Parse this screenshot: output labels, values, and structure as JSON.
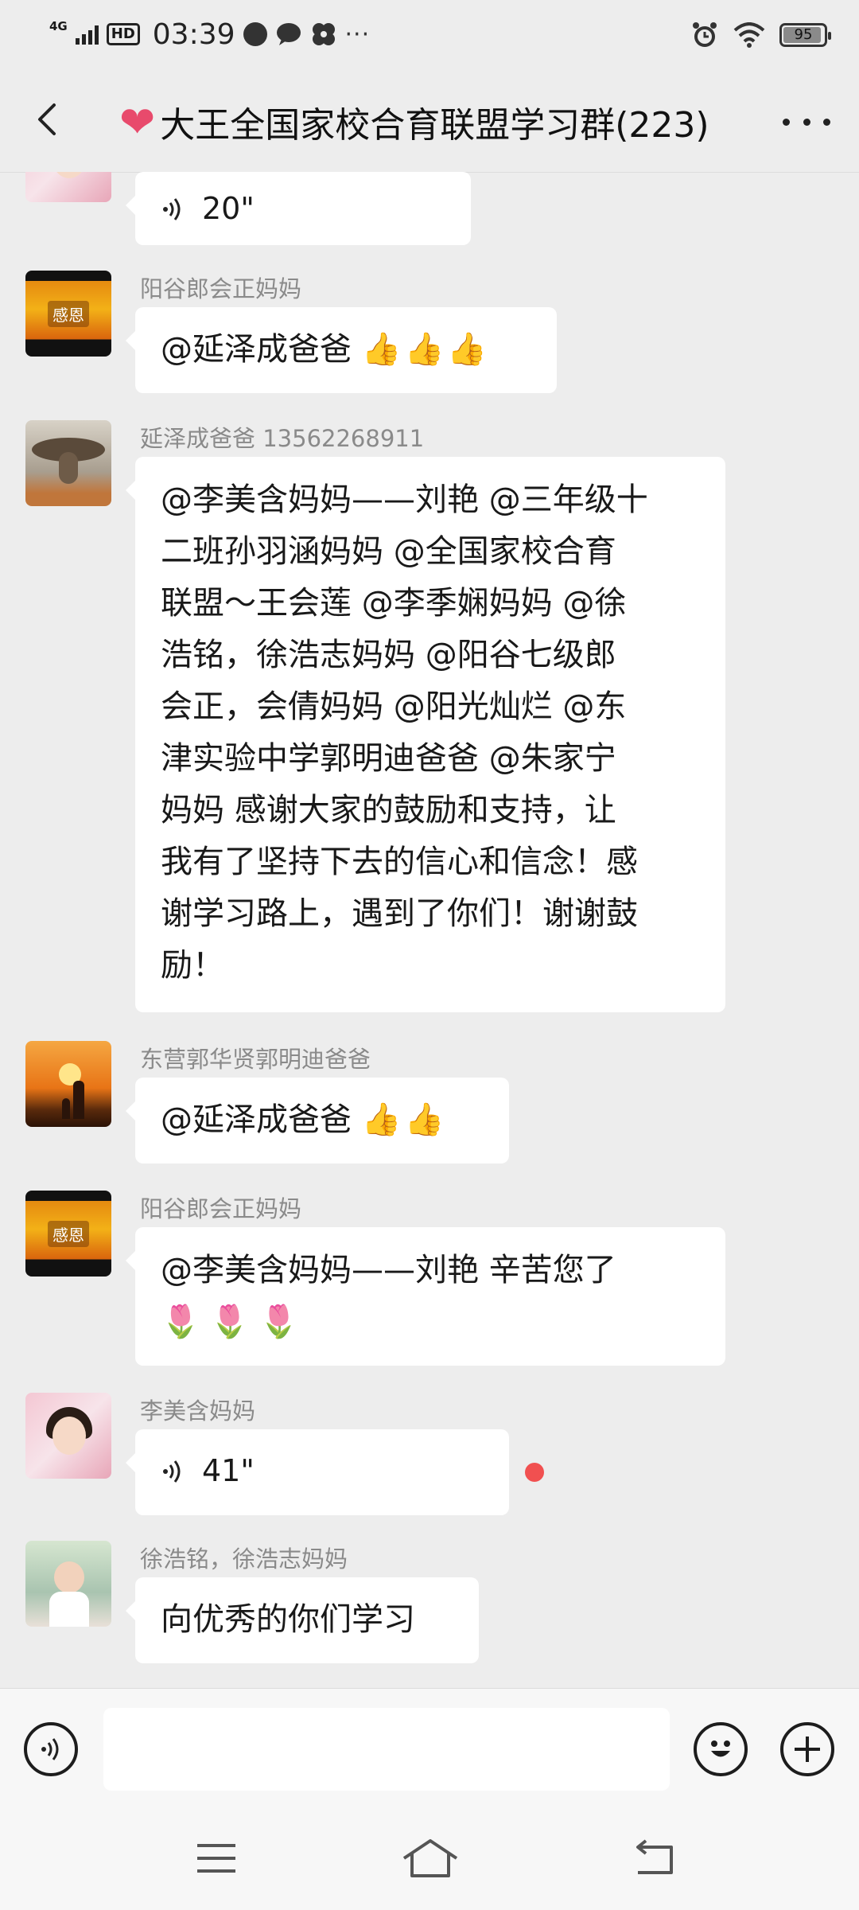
{
  "status_bar": {
    "network": "4G",
    "hd": "HD",
    "time": "03:39",
    "more": "···",
    "battery": "95",
    "battery_level": 0.95
  },
  "header": {
    "title": "大王全国家校合育联盟学习群(223)"
  },
  "messages": [
    {
      "sender": "",
      "type": "voice",
      "duration": "20\""
    },
    {
      "sender": "阳谷郎会正妈妈",
      "type": "text",
      "text": "@延泽成爸爸",
      "emoji": "👍👍👍",
      "avatar_text": "感恩"
    },
    {
      "sender": "延泽成爸爸  13562268911",
      "type": "text",
      "lines": [
        "@李美含妈妈——刘艳 @三年级十",
        "二班孙羽涵妈妈 @全国家校合育",
        "联盟～王会莲 @李季娴妈妈 @徐",
        "浩铭，徐浩志妈妈 @阳谷七级郎",
        "会正，会倩妈妈 @阳光灿烂 @东",
        "津实验中学郭明迪爸爸 @朱家宁",
        "妈妈  感谢大家的鼓励和支持，让",
        "我有了坚持下去的信心和信念！感",
        "谢学习路上，遇到了你们！谢谢鼓",
        "励！"
      ]
    },
    {
      "sender": "东营郭华贤郭明迪爸爸",
      "type": "text",
      "text": "@延泽成爸爸",
      "emoji": "👍👍"
    },
    {
      "sender": "阳谷郎会正妈妈",
      "type": "text",
      "text": "@李美含妈妈——刘艳  辛苦您了",
      "emoji": "🌷🌷🌷",
      "avatar_text": "感恩"
    },
    {
      "sender": "李美含妈妈",
      "type": "voice",
      "duration": "41\"",
      "unread": true
    },
    {
      "sender": "徐浩铭，徐浩志妈妈",
      "type": "text",
      "text": "向优秀的你们学习"
    }
  ],
  "input_bar": {
    "icons": [
      "voice-icon",
      "emoji-icon",
      "plus-icon"
    ]
  },
  "nav_bar": {
    "icons": [
      "menu-icon",
      "home-icon",
      "back-icon"
    ]
  }
}
